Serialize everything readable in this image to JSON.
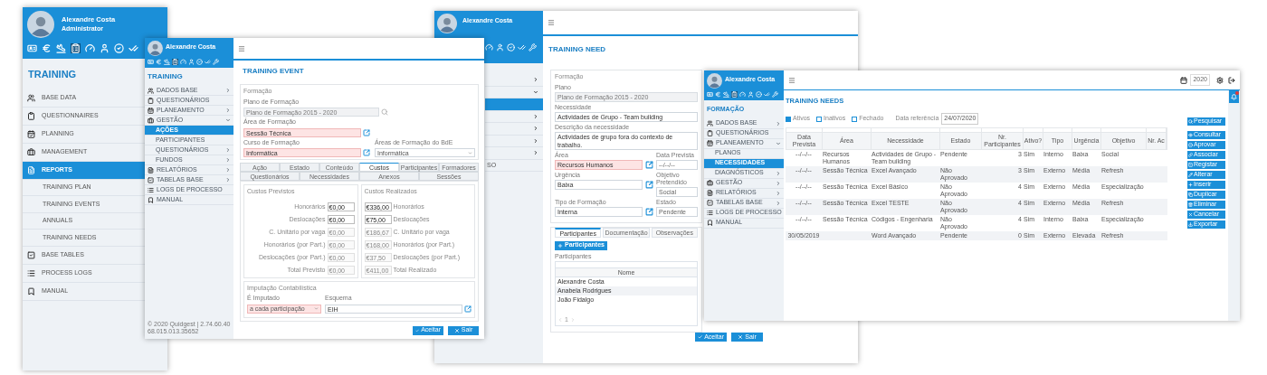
{
  "overview_window": {
    "user": {
      "name": "Alexandre Costa",
      "role": "Administrator"
    },
    "section_title": "TRAINING",
    "menu": [
      {
        "label": "BASE DATA",
        "selected": false
      },
      {
        "label": "QUESTIONNAIRES",
        "selected": false
      },
      {
        "label": "PLANNING",
        "selected": false
      },
      {
        "label": "MANAGEMENT",
        "selected": false
      },
      {
        "label": "REPORTS",
        "selected": true,
        "children": [
          {
            "label": "TRAINING PLAN",
            "selected": false
          },
          {
            "label": "TRAINING EVENTS",
            "selected": false
          },
          {
            "label": "ANNUALS",
            "selected": false
          },
          {
            "label": "TRAINING NEEDS",
            "selected": false
          }
        ]
      },
      {
        "label": "BASE TABLES",
        "selected": false
      },
      {
        "label": "PROCESS LOGS",
        "selected": false
      },
      {
        "label": "MANUAL",
        "selected": false
      }
    ]
  },
  "event_window": {
    "user": {
      "name": "Alexandre Costa"
    },
    "section_title": "TRAINING",
    "menu": [
      {
        "label": "DADOS BASE",
        "selected": false,
        "expanded": false
      },
      {
        "label": "QUESTIONÁRIOS",
        "selected": false
      },
      {
        "label": "PLANEAMENTO",
        "selected": false,
        "expanded": false
      },
      {
        "label": "GESTÃO",
        "selected": false,
        "expanded": true,
        "children": [
          {
            "label": "AÇÕES",
            "selected": true
          },
          {
            "label": "PARTICIPANTES",
            "selected": false
          },
          {
            "label": "QUESTIONÁRIOS",
            "selected": false,
            "expanded": false
          },
          {
            "label": "FUNDOS",
            "selected": false,
            "expanded": false
          }
        ]
      },
      {
        "label": "RELATÓRIOS",
        "selected": false,
        "expanded": false
      },
      {
        "label": "TABELAS BASE",
        "selected": false,
        "expanded": false
      },
      {
        "label": "LOGS DE PROCESSO",
        "selected": false
      },
      {
        "label": "MANUAL",
        "selected": false
      }
    ],
    "footer": "© 2020 Quidgest | 2.74.60.4068.015.013.35652",
    "page_title": "TRAINING EVENT",
    "formacao": {
      "legend": "Formação",
      "fields": [
        {
          "label": "Plano de Formação",
          "value": "Plano de Formação 2015 - 2020",
          "kind": "readonly"
        },
        {
          "label": "Área de Formação",
          "value": "Sessão Técnica",
          "kind": "lookup",
          "required": true
        },
        {
          "label": "Curso de Formação",
          "value": "Informática",
          "kind": "lookup",
          "required": true
        },
        {
          "label": "Áreas de Formação do BdE",
          "value": "Informática",
          "kind": "select",
          "required": false
        }
      ]
    },
    "tabs_top": [
      {
        "label": "Ação",
        "selected": false
      },
      {
        "label": "Estado",
        "selected": false
      },
      {
        "label": "Conteúdo",
        "selected": false
      },
      {
        "label": "Custos",
        "selected": true
      },
      {
        "label": "Participantes",
        "selected": false
      },
      {
        "label": "Formadores",
        "selected": false
      }
    ],
    "tabs_bottom": [
      {
        "label": "Questionários",
        "selected": false
      },
      {
        "label": "Necessidades",
        "selected": false
      },
      {
        "label": "Anexos",
        "selected": false
      },
      {
        "label": "Sessões",
        "selected": false
      }
    ],
    "planned_costs": {
      "legend": "Custos Previstos",
      "rows": [
        {
          "label": "Honorários",
          "value": "€0,00",
          "editable": true
        },
        {
          "label": "Deslocações",
          "value": "€0,00",
          "editable": true
        },
        {
          "label": "C. Unitário por vaga",
          "value": "€0,00",
          "editable": false
        },
        {
          "label": "Honorários (por Part.)",
          "value": "€0,00",
          "editable": false
        },
        {
          "label": "Deslocações (por Part.)",
          "value": "€0,00",
          "editable": false
        },
        {
          "label": "Total Previsto",
          "value": "€0,00",
          "editable": false
        }
      ]
    },
    "actual_costs": {
      "legend": "Custos Realizados",
      "rows": [
        {
          "label": "Honorários",
          "value": "€336,00",
          "editable": true
        },
        {
          "label": "Deslocações",
          "value": "€75,00",
          "editable": true
        },
        {
          "label": "C. Unitário por vaga",
          "value": "€186,67",
          "editable": false
        },
        {
          "label": "Honorários (por Part.)",
          "value": "€168,00",
          "editable": false
        },
        {
          "label": "Deslocações (por Part.)",
          "value": "€37,50",
          "editable": false
        },
        {
          "label": "Total Realizado",
          "value": "€411,00",
          "editable": false
        }
      ]
    },
    "accounting": {
      "legend": "Imputação Contabilística",
      "fields": [
        {
          "label": "É Imputado",
          "value": "a cada participação",
          "kind": "select",
          "required": true
        },
        {
          "label": "Esquema",
          "value": "EIH",
          "kind": "lookup",
          "required": false
        }
      ]
    },
    "buttons": [
      {
        "label": "Aceitar",
        "kind": "accept"
      },
      {
        "label": "Sair",
        "kind": "exit"
      }
    ]
  },
  "need_window": {
    "user": {
      "name": "Alexandre Costa"
    },
    "menu": [
      {
        "expanded": false
      },
      {
        "expanded": true
      },
      {
        "selected": true
      },
      {
        "expanded": false
      },
      {
        "expanded": false
      },
      {
        "expanded": false
      },
      {
        "expanded": false
      },
      {
        "label": "SO"
      }
    ],
    "page_title": "TRAINING NEED",
    "formacao": {
      "legend": "Formação",
      "fields": [
        {
          "label": "Plano",
          "value": "Plano de Formação 2015 - 2020",
          "kind": "readonly"
        },
        {
          "label": "Necessidade",
          "value": "Actividades de Grupo - Team building",
          "kind": "text"
        },
        {
          "label": "Descrição da necessidade",
          "value": "Actividades de grupo fora do contexto de trabalho.",
          "kind": "textarea"
        },
        {
          "label": "Área",
          "value": "Recursos Humanos",
          "kind": "lookup",
          "required": true
        },
        {
          "label": "Data Prevista",
          "value": "--/--/--",
          "kind": "side"
        },
        {
          "label": "Urgência",
          "value": "Baixa",
          "kind": "lookup",
          "required": false
        },
        {
          "label": "Objetivo Pretendido",
          "value": "Social",
          "kind": "side"
        },
        {
          "label": "Tipo de Formação",
          "value": "Interna",
          "kind": "lookup",
          "required": false
        },
        {
          "label": "Estado",
          "value": "Pendente",
          "kind": "side"
        }
      ]
    },
    "tabs": [
      {
        "label": "Participantes",
        "selected": true
      },
      {
        "label": "Documentação",
        "selected": false
      },
      {
        "label": "Observações",
        "selected": false
      }
    ],
    "add_button": "Participantes",
    "list_label": "Participantes",
    "column": "Nome",
    "participants": [
      "Alexandre Costa",
      "Anabela Rodrigues",
      "João Fidalgo"
    ],
    "pager": "1",
    "buttons": [
      {
        "label": "Aceitar",
        "kind": "accept"
      },
      {
        "label": "Sair",
        "kind": "exit"
      }
    ]
  },
  "needs_window": {
    "user": {
      "name": "Alexandre Costa"
    },
    "section_title": "FORMAÇÃO",
    "menu": [
      {
        "label": "DADOS BASE",
        "selected": false,
        "expanded": false
      },
      {
        "label": "QUESTIONÁRIOS",
        "selected": false
      },
      {
        "label": "PLANEAMENTO",
        "selected": false,
        "expanded": true,
        "children": [
          {
            "label": "PLANOS",
            "selected": false
          },
          {
            "label": "NECESSIDADES",
            "selected": true
          },
          {
            "label": "DIAGNÓSTICOS",
            "selected": false,
            "expanded": false
          }
        ]
      },
      {
        "label": "GESTÃO",
        "selected": false,
        "expanded": false
      },
      {
        "label": "RELATÓRIOS",
        "selected": false,
        "expanded": false
      },
      {
        "label": "TABELAS BASE",
        "selected": false,
        "expanded": false
      },
      {
        "label": "LOGS DE PROCESSO",
        "selected": false
      },
      {
        "label": "MANUAL",
        "selected": false
      }
    ],
    "year": "2020",
    "page_title": "TRAINING NEEDS",
    "filters": [
      {
        "label": "Ativos",
        "checked": true
      },
      {
        "label": "Inativos",
        "checked": false
      },
      {
        "label": "Fechado",
        "checked": false
      }
    ],
    "reference": {
      "label": "Data referência",
      "value": "24/07/2020"
    },
    "table": {
      "columns": [
        "Data Prevista",
        "Área",
        "Necessidade",
        "Estado",
        "Nr. Participantes",
        "Ativo?",
        "Tipo",
        "Urgência",
        "Objetivo",
        "Nr. Ac"
      ],
      "rows": [
        [
          "--/--/--",
          "Recursos Humanos",
          "Actividades de Grupo - Team building",
          "Pendente",
          "3",
          "Sim",
          "Interno",
          "Baixa",
          "Social",
          ""
        ],
        [
          "--/--/--",
          "Sessão Técnica",
          "Excel Avançado",
          "Não Aprovado",
          "3",
          "Sim",
          "Externo",
          "Média",
          "Refresh",
          ""
        ],
        [
          "--/--/--",
          "Sessão Técnica",
          "Excel Básico",
          "Não Aprovado",
          "4",
          "Sim",
          "Externo",
          "Média",
          "Especialização",
          ""
        ],
        [
          "--/--/--",
          "Sessão Técnica",
          "Excel TESTE",
          "Não Aprovado",
          "4",
          "Sim",
          "Externo",
          "Média",
          "Refresh",
          ""
        ],
        [
          "--/--/--",
          "Sessão Técnica",
          "Códigos - Engenharia",
          "Não Aprovado",
          "4",
          "Sim",
          "Interno",
          "Baixa",
          "Especialização",
          ""
        ],
        [
          "30/05/2019",
          "",
          "Word Avançado",
          "Pendente",
          "0",
          "Sim",
          "Externo",
          "Elevada",
          "Refresh",
          ""
        ]
      ]
    },
    "search_button": "Pesquisar",
    "actions": [
      "Consultar",
      "Aprovar",
      "Associar",
      "Registar",
      "Alterar",
      "Inserir",
      "Duplicar",
      "Eliminar",
      "Cancelar",
      "Exportar"
    ]
  }
}
